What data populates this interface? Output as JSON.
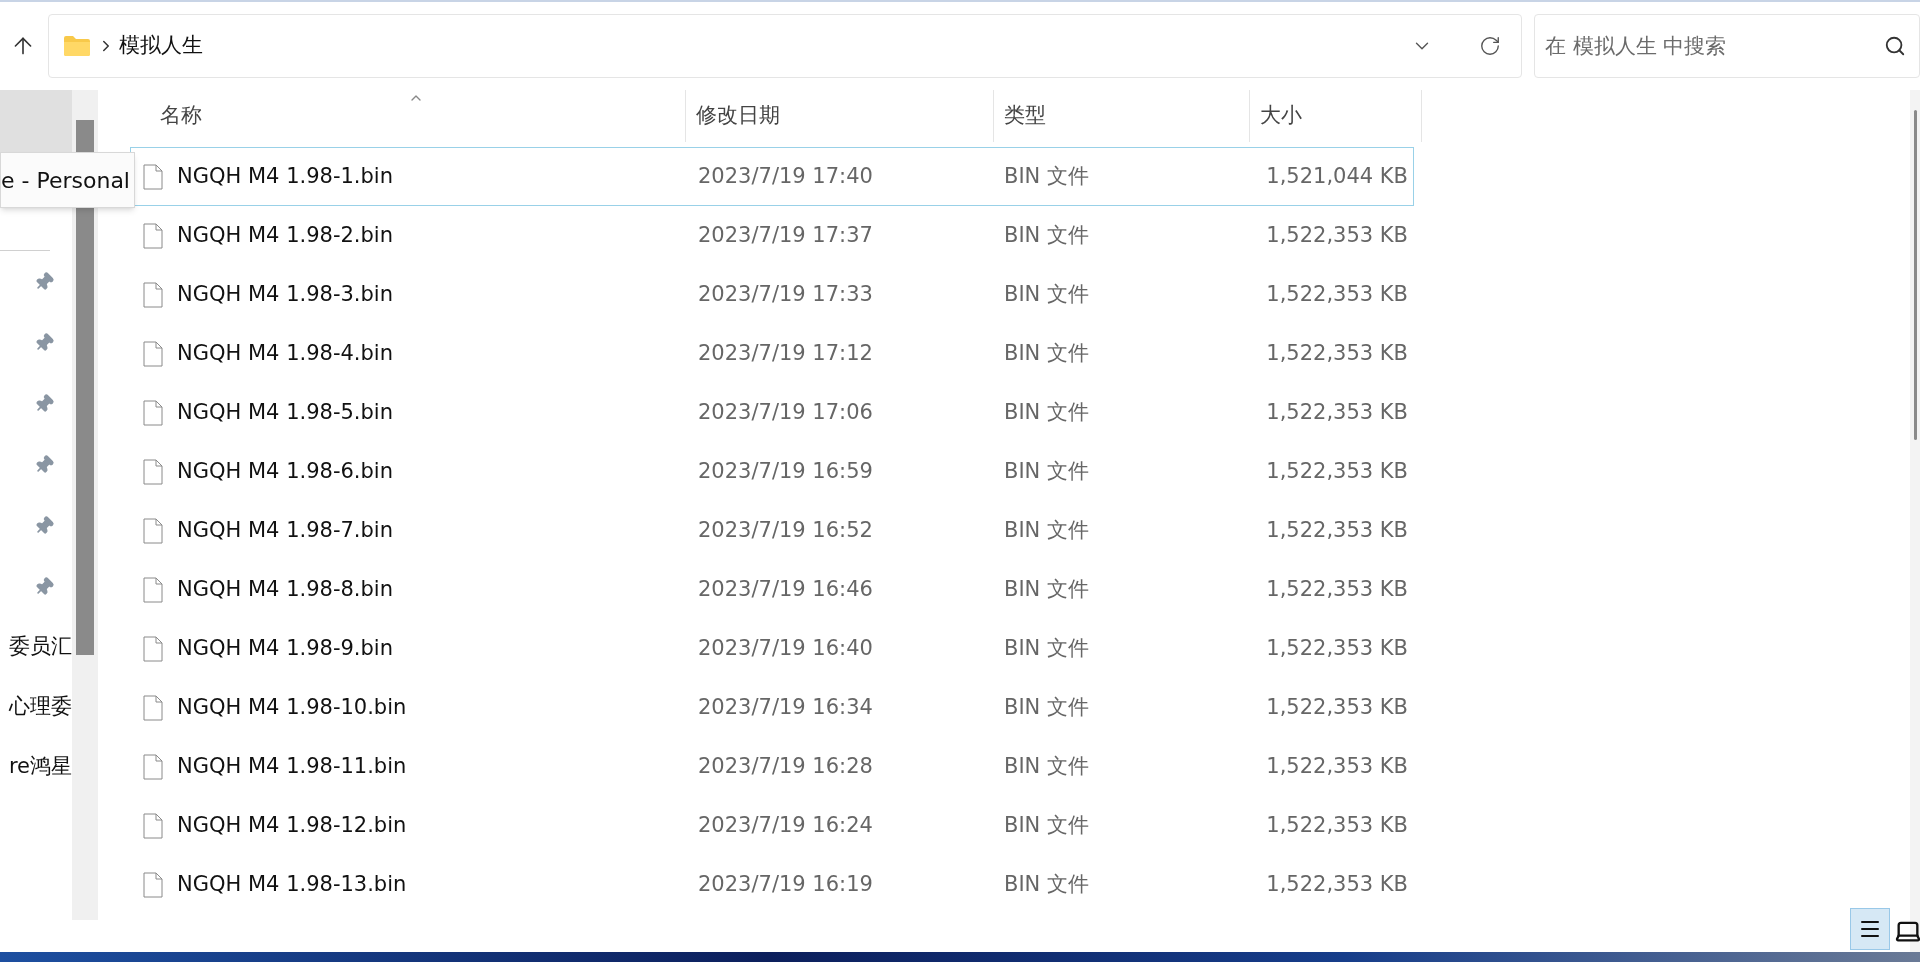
{
  "address": {
    "path": "模拟人生"
  },
  "search": {
    "placeholder": "在 模拟人生 中搜索"
  },
  "tooltip": "e - Personal",
  "sidebar": {
    "items": [
      {
        "kind": "pin"
      },
      {
        "kind": "pin"
      },
      {
        "kind": "pin"
      },
      {
        "kind": "pin"
      },
      {
        "kind": "pin"
      },
      {
        "kind": "pin"
      },
      {
        "kind": "text",
        "label": "委员汇"
      },
      {
        "kind": "text",
        "label": "心理委"
      },
      {
        "kind": "text",
        "label": "re鸿星"
      }
    ]
  },
  "table": {
    "columns": [
      "名称",
      "修改日期",
      "类型",
      "大小"
    ],
    "rows": [
      {
        "name": "NGQH M4 1.98-1.bin",
        "date": "2023/7/19 17:40",
        "type": "BIN 文件",
        "size": "1,521,044 KB",
        "focused": true
      },
      {
        "name": "NGQH M4 1.98-2.bin",
        "date": "2023/7/19 17:37",
        "type": "BIN 文件",
        "size": "1,522,353 KB",
        "focused": false
      },
      {
        "name": "NGQH M4 1.98-3.bin",
        "date": "2023/7/19 17:33",
        "type": "BIN 文件",
        "size": "1,522,353 KB",
        "focused": false
      },
      {
        "name": "NGQH M4 1.98-4.bin",
        "date": "2023/7/19 17:12",
        "type": "BIN 文件",
        "size": "1,522,353 KB",
        "focused": false
      },
      {
        "name": "NGQH M4 1.98-5.bin",
        "date": "2023/7/19 17:06",
        "type": "BIN 文件",
        "size": "1,522,353 KB",
        "focused": false
      },
      {
        "name": "NGQH M4 1.98-6.bin",
        "date": "2023/7/19 16:59",
        "type": "BIN 文件",
        "size": "1,522,353 KB",
        "focused": false
      },
      {
        "name": "NGQH M4 1.98-7.bin",
        "date": "2023/7/19 16:52",
        "type": "BIN 文件",
        "size": "1,522,353 KB",
        "focused": false
      },
      {
        "name": "NGQH M4 1.98-8.bin",
        "date": "2023/7/19 16:46",
        "type": "BIN 文件",
        "size": "1,522,353 KB",
        "focused": false
      },
      {
        "name": "NGQH M4 1.98-9.bin",
        "date": "2023/7/19 16:40",
        "type": "BIN 文件",
        "size": "1,522,353 KB",
        "focused": false
      },
      {
        "name": "NGQH M4 1.98-10.bin",
        "date": "2023/7/19 16:34",
        "type": "BIN 文件",
        "size": "1,522,353 KB",
        "focused": false
      },
      {
        "name": "NGQH M4 1.98-11.bin",
        "date": "2023/7/19 16:28",
        "type": "BIN 文件",
        "size": "1,522,353 KB",
        "focused": false
      },
      {
        "name": "NGQH M4 1.98-12.bin",
        "date": "2023/7/19 16:24",
        "type": "BIN 文件",
        "size": "1,522,353 KB",
        "focused": false
      },
      {
        "name": "NGQH M4 1.98-13.bin",
        "date": "2023/7/19 16:19",
        "type": "BIN 文件",
        "size": "1,522,353 KB",
        "focused": false
      }
    ]
  }
}
